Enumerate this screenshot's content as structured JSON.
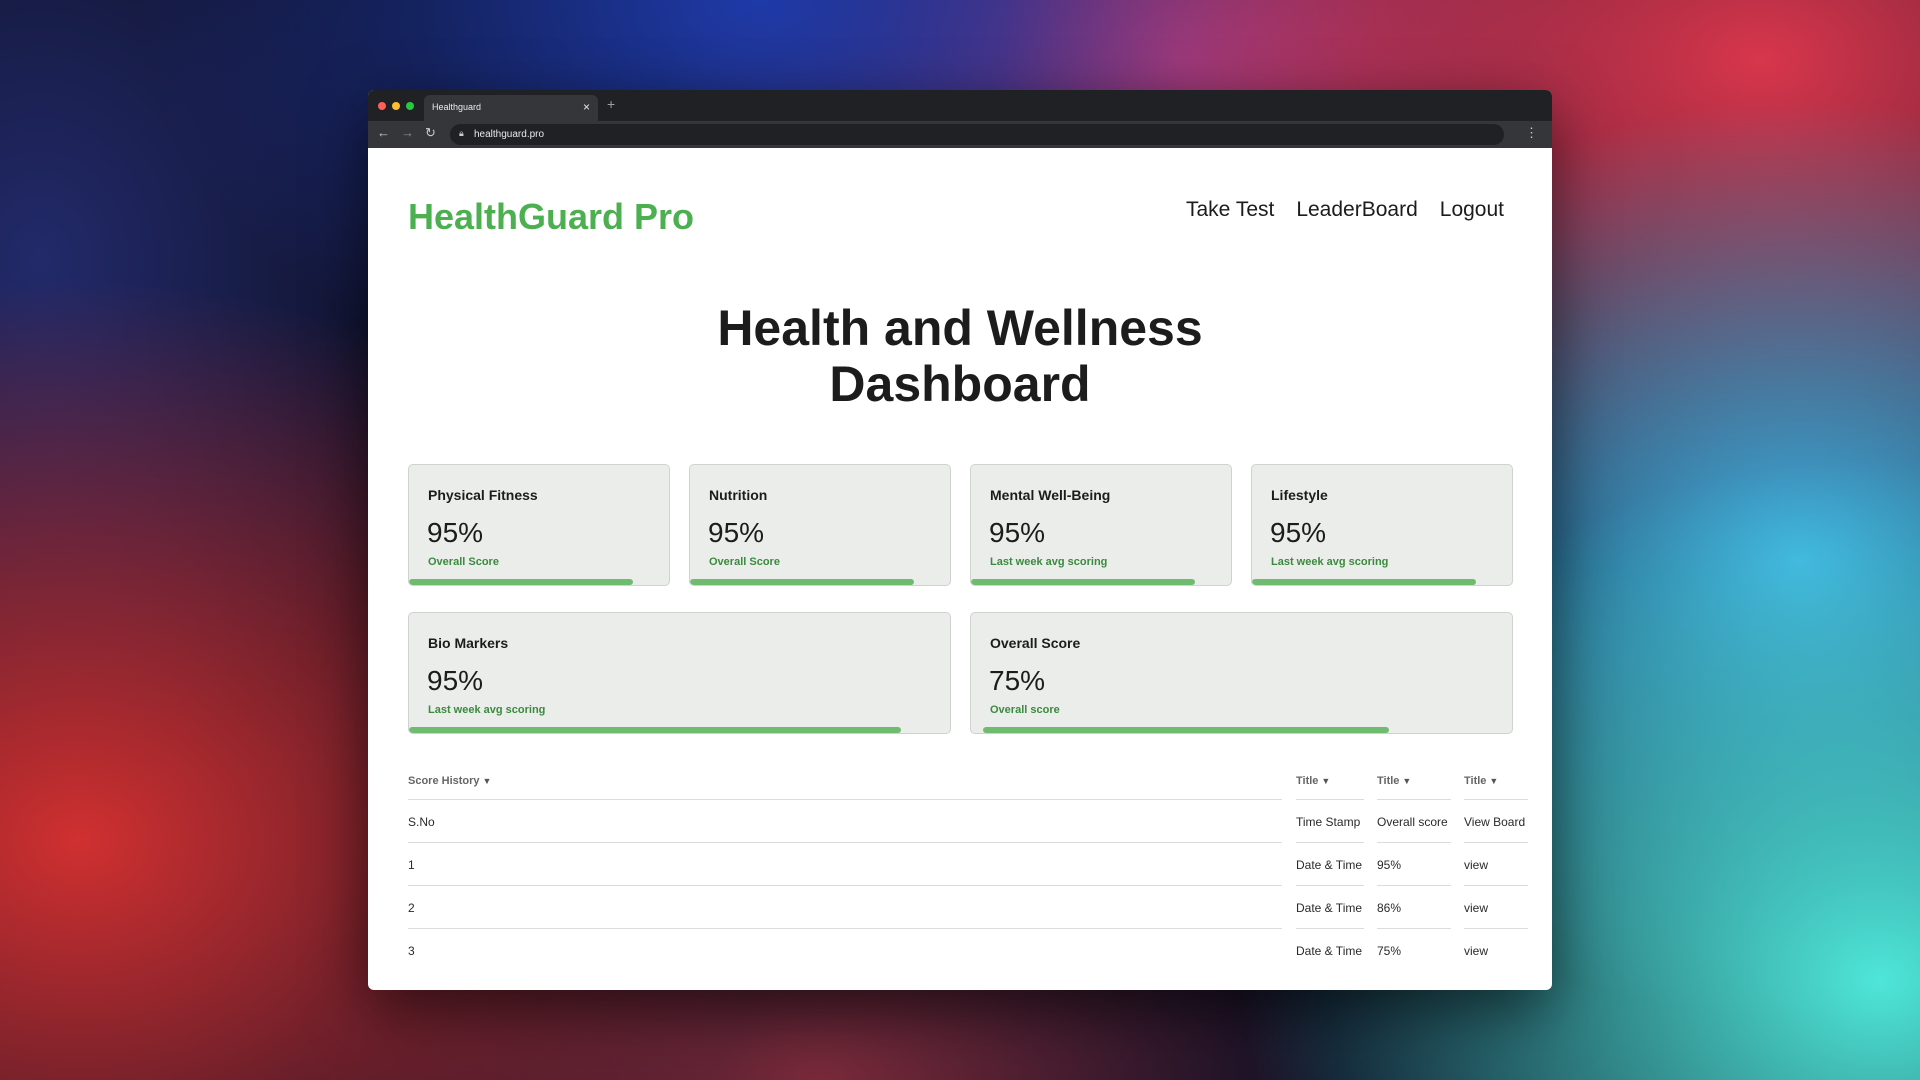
{
  "browser": {
    "tab_title": "Healthguard",
    "url": "healthguard.pro"
  },
  "header": {
    "brand": "HealthGuard Pro",
    "nav": [
      "Take Test",
      "LeaderBoard",
      "Logout"
    ]
  },
  "page": {
    "title_line1": "Health and Wellness",
    "title_line2": "Dashboard"
  },
  "cards": [
    {
      "title": "Physical Fitness",
      "value": "95%",
      "subtitle": "Overall Score",
      "progress": 0.86
    },
    {
      "title": "Nutrition",
      "value": "95%",
      "subtitle": "Overall Score",
      "progress": 0.86
    },
    {
      "title": "Mental Well-Being",
      "value": "95%",
      "subtitle": "Last week avg scoring",
      "progress": 0.86
    },
    {
      "title": "Lifestyle",
      "value": "95%",
      "subtitle": "Last week avg scoring",
      "progress": 0.86
    },
    {
      "title": "Bio Markers",
      "value": "95%",
      "subtitle": "Last week avg scoring",
      "progress": 0.91
    },
    {
      "title": "Overall Score",
      "value": "75%",
      "subtitle": "Overall score",
      "progress": 0.75
    }
  ],
  "score_history": {
    "header_labels": [
      "Score History",
      "Title",
      "Title",
      "Title"
    ],
    "columns": [
      "S.No",
      "Time Stamp",
      "Overall score",
      "View Board"
    ],
    "rows": [
      [
        "1",
        "Date & Time",
        "95%",
        "view"
      ],
      [
        "2",
        "Date & Time",
        "86%",
        "view"
      ],
      [
        "3",
        "Date & Time",
        "75%",
        "view"
      ]
    ]
  },
  "colors": {
    "brand": "#4caf50",
    "progress": "#6fbb6f",
    "subtitle": "#3b8a3e",
    "card_bg": "#ebedeb"
  }
}
